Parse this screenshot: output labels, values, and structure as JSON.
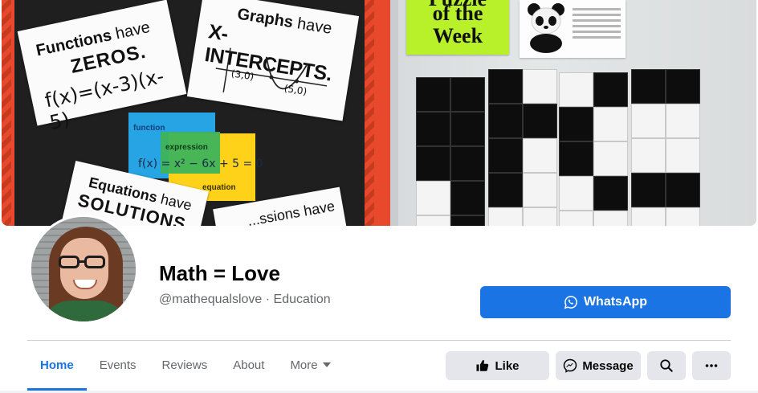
{
  "cover": {
    "sign1_title_a": "Functions",
    "sign1_title_b": "have",
    "sign1_keyword": "ZEROS.",
    "sign1_formula": "f(x)=(x-3)(x-5)",
    "sign2_title_a": "Graphs",
    "sign2_title_b": "have",
    "sign2_keyword": "X-INTERCEPTS.",
    "sign2_point_a": "(3,0)",
    "sign2_point_b": "(5,0)",
    "card_function": "function",
    "card_expression": "expression",
    "card_equation": "equation",
    "card_formula": "f(x) = x² − 6x + 5 = 0",
    "sign3_title_a": "Equations",
    "sign3_title_b": "have",
    "sign3_keyword": "SOLUTIONS",
    "sign4_title": "...ssions have",
    "puzzle_line1": "Puzzle",
    "puzzle_line2": "of the",
    "puzzle_line3": "Week"
  },
  "profile": {
    "name": "Math = Love",
    "handle_category": "@mathequalslove · Education",
    "primary_action": "WhatsApp"
  },
  "tabs": [
    {
      "label": "Home",
      "active": true
    },
    {
      "label": "Events",
      "active": false
    },
    {
      "label": "Reviews",
      "active": false
    },
    {
      "label": "About",
      "active": false
    },
    {
      "label": "More",
      "active": false
    }
  ],
  "actions": {
    "like": "Like",
    "message": "Message",
    "search_icon": "search-icon",
    "more_icon": "more-icon"
  },
  "colors": {
    "primary_blue": "#1b74e4",
    "button_gray": "#e4e6eb",
    "secondary_text": "#65676b"
  }
}
